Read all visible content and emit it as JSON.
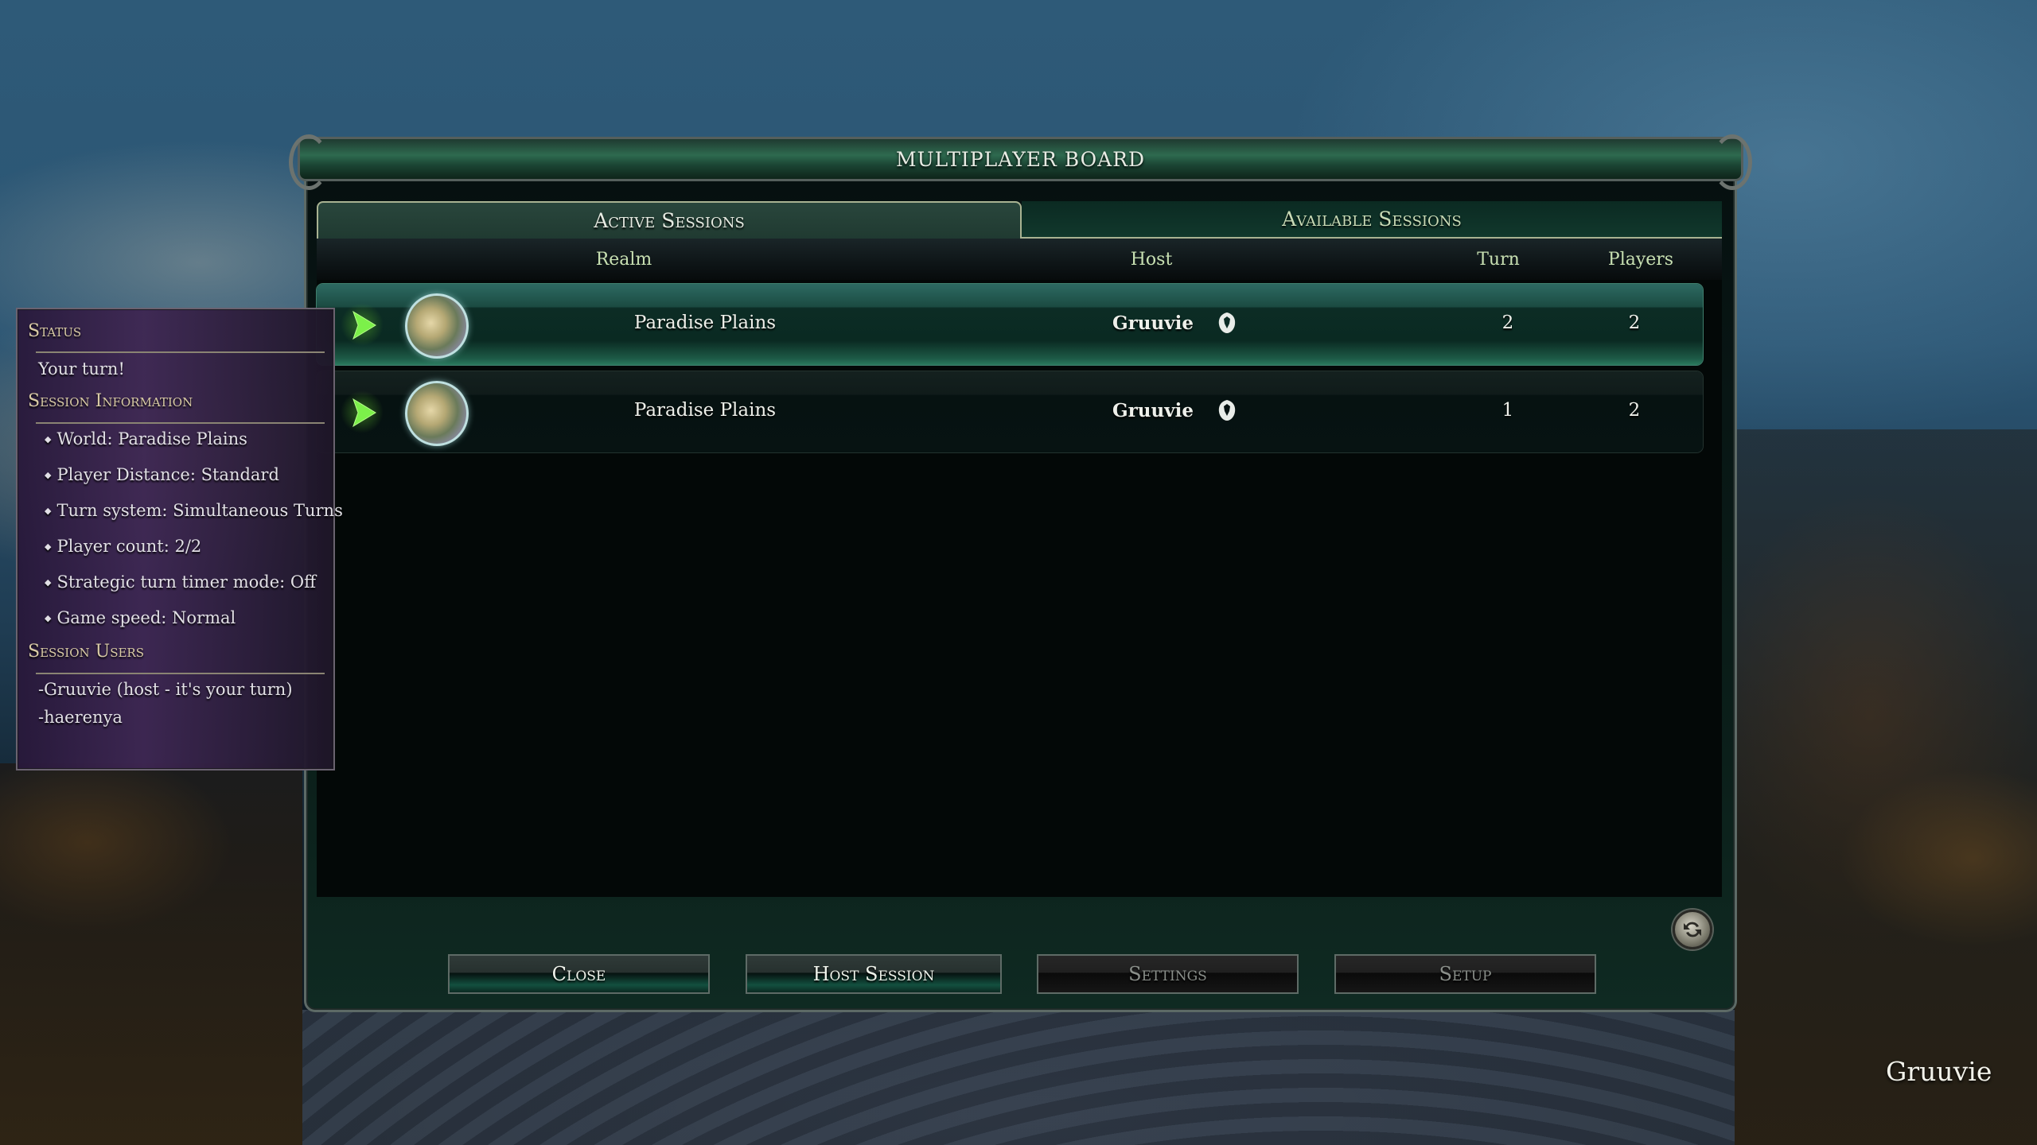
{
  "window": {
    "title": "Multiplayer Board"
  },
  "tabs": [
    {
      "label": "Active Sessions",
      "active": true
    },
    {
      "label": "Available Sessions",
      "active": false
    }
  ],
  "columns": {
    "realm": "Realm",
    "host": "Host",
    "turn": "Turn",
    "players": "Players"
  },
  "sessions": [
    {
      "realm": "Paradise Plains",
      "host": "Gruuvie",
      "host_icon": "faction-emblem-icon",
      "turn": "2",
      "players": "2",
      "selected": true,
      "action_icon": "play-icon"
    },
    {
      "realm": "Paradise Plains",
      "host": "Gruuvie",
      "host_icon": "faction-emblem-icon",
      "turn": "1",
      "players": "2",
      "selected": false,
      "action_icon": "play-icon"
    }
  ],
  "buttons": {
    "close": "Close",
    "host_session": "Host Session",
    "settings": "Settings",
    "setup": "Setup",
    "refresh_icon": "refresh-icon"
  },
  "info_panel": {
    "status_heading": "Status",
    "status_text": "Your turn!",
    "session_info_heading": "Session Information",
    "session_info": [
      "World: Paradise Plains",
      "Player Distance: Standard",
      "Turn system: Simultaneous Turns",
      "Player count: 2/2",
      "Strategic turn timer mode: Off",
      "Game speed: Normal"
    ],
    "session_users_heading": "Session Users",
    "session_users": [
      "-Gruuvie (host - it's your turn)",
      "-haerenya"
    ]
  },
  "player_name": "Gruuvie",
  "colors": {
    "accent_green": "#2a7a5e",
    "play_green": "#7cf04a",
    "tab_border": "#a9b392",
    "header_text": "#c8e0b2",
    "side_panel_purple": "#3e2652"
  }
}
